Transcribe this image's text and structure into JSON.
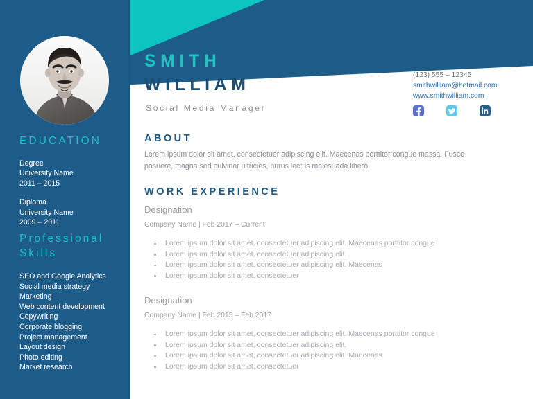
{
  "theme": {
    "navy": "#1d5b89",
    "teal": "#0cc5c0",
    "heading_navy": "#21587f",
    "body_gray": "#8a9096",
    "link_blue": "#2f6fb0",
    "white": "#ffffff"
  },
  "header": {
    "first_name": "SMITH",
    "last_name": "WILLIAM",
    "job_title": "Social Media Manager"
  },
  "contact": {
    "phone": "(123) 555 – 12345",
    "email": "smithwilliam@hotmail.com",
    "website": "www.smithwilliam.com",
    "socials": [
      {
        "name": "facebook",
        "color": "#5a6fd0"
      },
      {
        "name": "twitter",
        "color": "#5ec8e8"
      },
      {
        "name": "linkedin",
        "color": "#2a5f87"
      }
    ]
  },
  "sidebar": {
    "education": {
      "heading": "EDUCATION",
      "entries": [
        {
          "degree": "Degree",
          "university": "University Name",
          "years": "2011  – 2015"
        },
        {
          "degree": " Diploma",
          "university": "University Name",
          "years": "2009  – 2011"
        }
      ]
    },
    "skills": {
      "heading": "Professional\nSkills",
      "items": [
        "SEO and Google Analytics",
        "Social media strategy",
        "Marketing",
        "Web content development",
        "Copywriting",
        "Corporate blogging",
        "Project management",
        "Layout design",
        "Photo editing",
        "Market research"
      ]
    }
  },
  "main": {
    "about": {
      "heading": "ABOUT",
      "body": "Lorem ipsum dolor sit amet, consectetuer adipiscing elit. Maecenas porttitor congue massa. Fusce posuere, magna sed pulvinar ultricies, purus lectus malesuada libero,"
    },
    "work": {
      "heading": "WORK EXPERIENCE",
      "jobs": [
        {
          "designation": "Designation",
          "meta": "Company Name | Feb 2017 – Current",
          "bullets": [
            "Lorem ipsum dolor sit amet, consectetuer adipiscing elit. Maecenas porttitor congue",
            "Lorem ipsum dolor sit amet, consectetuer adipiscing elit.",
            "Lorem ipsum dolor sit amet, consectetuer adipiscing elit. Maecenas",
            "Lorem ipsum dolor sit amet, consectetuer"
          ]
        },
        {
          "designation": "Designation",
          "meta": "Company Name | Feb 2015 – Feb 2017",
          "bullets": [
            "Lorem ipsum dolor sit amet, consectetuer adipiscing elit. Maecenas porttitor congue",
            "Lorem ipsum dolor sit amet, consectetuer adipiscing elit.",
            "Lorem ipsum dolor sit amet, consectetuer adipiscing elit. Maecenas",
            "Lorem ipsum dolor sit amet, consectetuer"
          ]
        }
      ]
    }
  }
}
